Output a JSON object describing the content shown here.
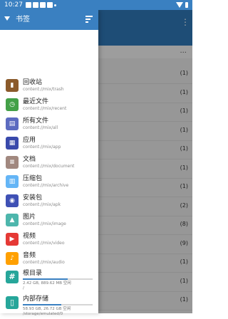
{
  "status_bar": {
    "time": "10:27",
    "colors": {
      "bar": "#3a80c1"
    }
  },
  "drawer": {
    "title": "书签",
    "sort_icon": "sort-icon",
    "bookmarks": [
      {
        "name": "回收站",
        "path": "content://mix/trash",
        "icon": "trash-icon",
        "color": "#8b5a2b",
        "glyph": "▮"
      },
      {
        "name": "最近文件",
        "path": "content://mix/recent",
        "icon": "clock-icon",
        "color": "#43a047",
        "glyph": "◷"
      },
      {
        "name": "所有文件",
        "path": "content://mix/all",
        "icon": "file-icon",
        "color": "#5c6bc0",
        "glyph": "▤"
      },
      {
        "name": "应用",
        "path": "content://mix/app",
        "icon": "apps-grid-icon",
        "color": "#3949ab",
        "glyph": "▦"
      },
      {
        "name": "文档",
        "path": "content://mix/document",
        "icon": "document-icon",
        "color": "#a1887f",
        "glyph": "≡"
      },
      {
        "name": "压缩包",
        "path": "content://mix/archive",
        "icon": "archive-icon",
        "color": "#64b5f6",
        "glyph": "▥"
      },
      {
        "name": "安装包",
        "path": "content://mix/apk",
        "icon": "android-icon",
        "color": "#3f51b5",
        "glyph": "◉"
      },
      {
        "name": "图片",
        "path": "content://mix/image",
        "icon": "image-icon",
        "color": "#4db6ac",
        "glyph": "▲"
      },
      {
        "name": "视频",
        "path": "content://mix/video",
        "icon": "play-icon",
        "color": "#e53935",
        "glyph": "▶"
      },
      {
        "name": "音频",
        "path": "content://mix/audio",
        "icon": "music-icon",
        "color": "#ffa000",
        "glyph": "♪"
      }
    ],
    "storage": [
      {
        "name": "根目录",
        "info": "2.42 GB, 889.62 MB 空闲",
        "path": "/",
        "icon": "hash-icon",
        "color": "#26a69a",
        "glyph": "#",
        "used_fraction": 0.64
      },
      {
        "name": "内部存储",
        "info": "58.93 GB, 26.72 GB 空闲",
        "path": "/storage/emulated/0",
        "icon": "phone-icon",
        "color": "#26a69a",
        "glyph": "▯",
        "used_fraction": 0.55
      }
    ]
  },
  "background": {
    "overflow_icon": "more-vertical-icon",
    "more_label": "...",
    "row_counts": [
      "(1)",
      "(1)",
      "(1)",
      "(1)",
      "(1)",
      "(1)",
      "(1)",
      "(2)",
      "(8)",
      "(9)",
      "(1)",
      "(1)",
      "(1)"
    ]
  }
}
